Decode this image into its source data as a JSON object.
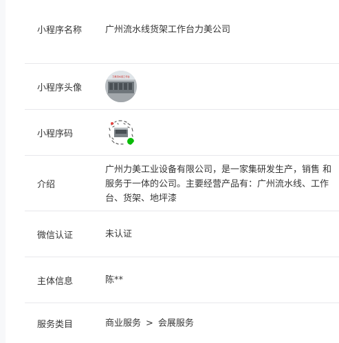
{
  "profile": {
    "name_label": "小程序名称",
    "name_value": "广州流水线货架工作台力美公司",
    "avatar_label": "小程序头像",
    "avatar_text": "力美流水线工作台",
    "code_label": "小程序码",
    "intro_label": "介绍",
    "intro_value": "广州力美工业设备有限公司，是一家集研发生产，销售 和服务于一体的公司。主要经营产品有：广州流水线、工作台、货架、地坪漆",
    "wechat_label": "微信认证",
    "wechat_value": "未认证",
    "subject_label": "主体信息",
    "subject_value": "陈**",
    "service_label": "服务类目",
    "service_primary": "商业服务",
    "service_separator": ">",
    "service_secondary": "会展服务"
  },
  "colors": {
    "text": "#353535",
    "divider": "#e7e7eb",
    "wechat_green": "#09bb07",
    "badge_red": "#e64340"
  },
  "icons": {
    "avatar": "factory-photo-avatar",
    "code": "miniprogram-code-icon"
  }
}
